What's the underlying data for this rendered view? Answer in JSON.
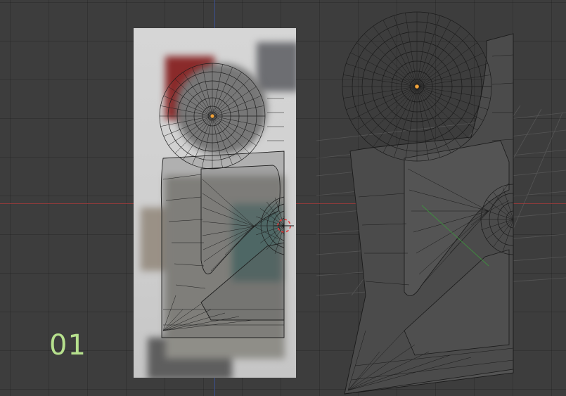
{
  "viewport": {
    "step_label": "01",
    "background_color": "#3d3d3d",
    "axis_x_color": "#8e3b3b",
    "axis_y_color": "#3c4f8d",
    "label_color": "#b6e08d",
    "origin_color": "#f2a33a",
    "cursor_color": "#e23a3a"
  },
  "objects": [
    {
      "name": "reference-image",
      "type": "background image"
    },
    {
      "name": "mesh-traced-on-reference",
      "type": "wireframe mesh"
    },
    {
      "name": "mesh-perspective-view",
      "type": "wireframe mesh"
    },
    {
      "name": "3d-cursor",
      "type": "cursor"
    }
  ]
}
